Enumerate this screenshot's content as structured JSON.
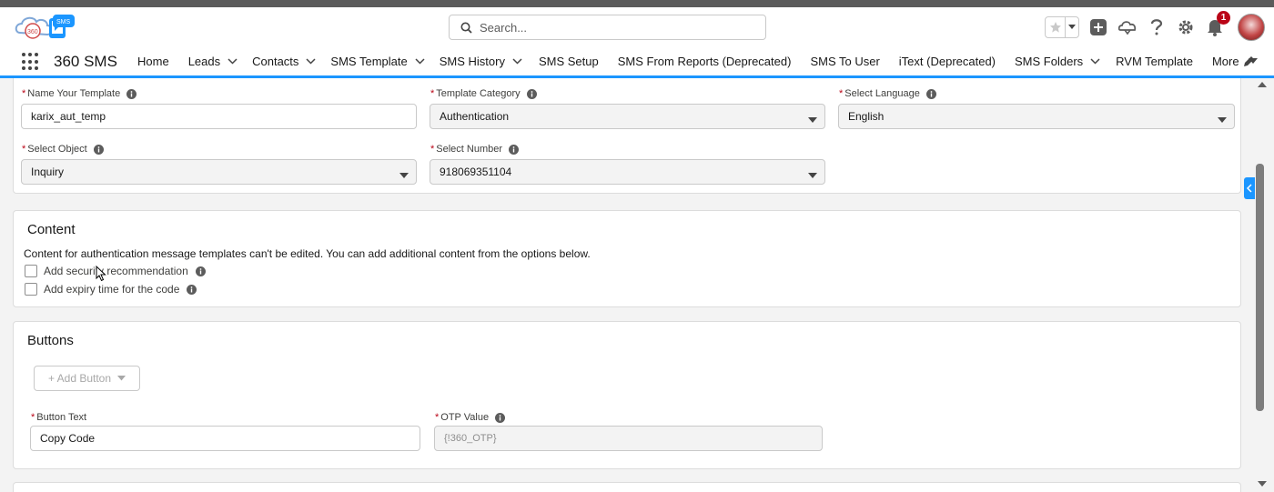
{
  "header": {
    "logo_text": "SMS",
    "search_placeholder": "Search...",
    "notification_count": "1"
  },
  "nav": {
    "app_name": "360 SMS",
    "items": [
      {
        "label": "Home",
        "dropdown": false
      },
      {
        "label": "Leads",
        "dropdown": true
      },
      {
        "label": "Contacts",
        "dropdown": true
      },
      {
        "label": "SMS Template",
        "dropdown": true
      },
      {
        "label": "SMS History",
        "dropdown": true
      },
      {
        "label": "SMS Setup",
        "dropdown": false
      },
      {
        "label": "SMS From Reports (Deprecated)",
        "dropdown": false
      },
      {
        "label": "SMS To User",
        "dropdown": false
      },
      {
        "label": "iText (Deprecated)",
        "dropdown": false
      },
      {
        "label": "SMS Folders",
        "dropdown": true
      },
      {
        "label": "RVM Template",
        "dropdown": false
      },
      {
        "label": "More",
        "dropdown": true
      }
    ]
  },
  "form": {
    "name_label": "Name Your Template",
    "name_value": "karix_aut_temp",
    "category_label": "Template Category",
    "category_value": "Authentication",
    "language_label": "Select Language",
    "language_value": "English",
    "object_label": "Select Object",
    "object_value": "Inquiry",
    "number_label": "Select Number",
    "number_value": "918069351104"
  },
  "content": {
    "title": "Content",
    "description": "Content for authentication message templates can't be edited. You can add additional content from the options below.",
    "option1": "Add security recommendation",
    "option2": "Add expiry time for the code"
  },
  "buttons": {
    "title": "Buttons",
    "add_button": "+ Add Button",
    "button_text_label": "Button Text",
    "button_text_value": "Copy Code",
    "otp_label": "OTP Value",
    "otp_value": "{!360_OTP}"
  },
  "colors": {
    "brand_blue": "#1b96ff",
    "required_red": "#ba0517"
  }
}
